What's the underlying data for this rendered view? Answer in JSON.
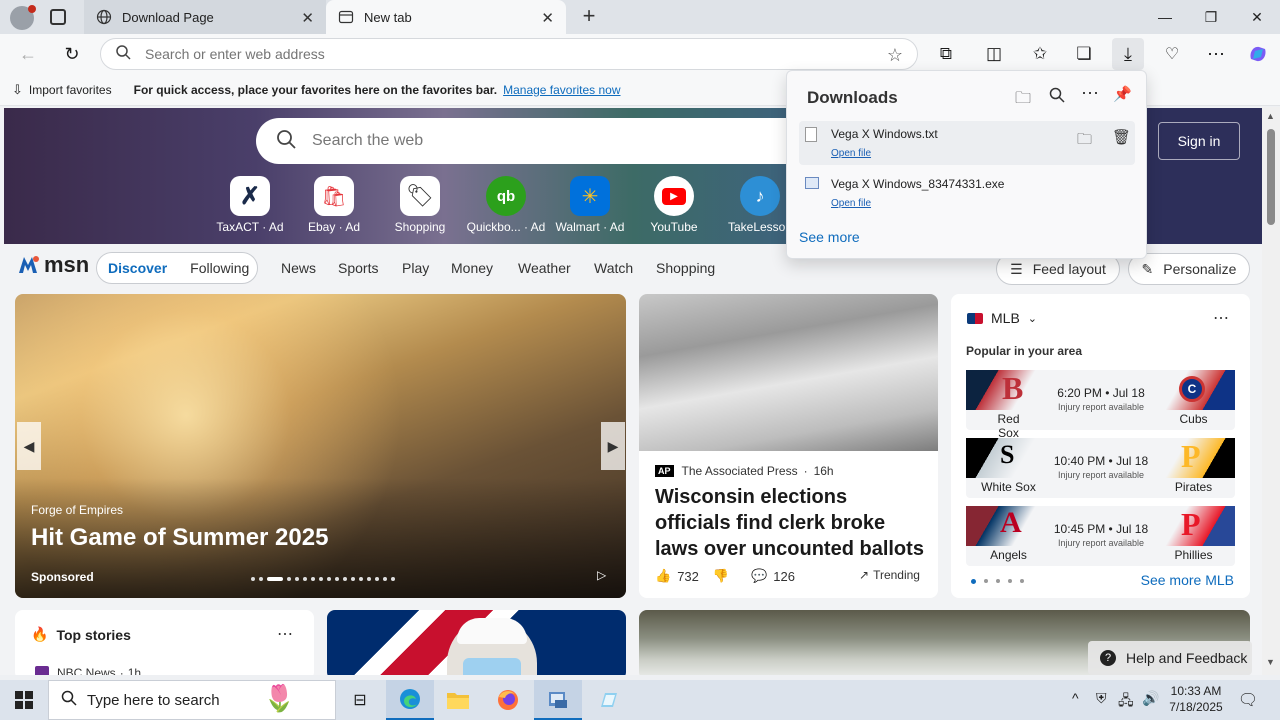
{
  "browser": {
    "tabs": [
      {
        "title": "Download Page"
      },
      {
        "title": "New tab"
      }
    ],
    "address": {
      "placeholder": "Search or enter web address"
    }
  },
  "favorites_bar": {
    "import_label": "Import favorites",
    "message": "For quick access, place your favorites here on the favorites bar.",
    "manage_link": "Manage favorites now"
  },
  "downloads": {
    "title": "Downloads",
    "items": [
      {
        "name": "Vega X Windows.txt",
        "action": "Open file"
      },
      {
        "name": "Vega X Windows_83474331.exe",
        "action": "Open file"
      }
    ],
    "see_more": "See more"
  },
  "hero": {
    "search_placeholder": "Search the web",
    "signin": "Sign in",
    "quicklinks": [
      {
        "label": "TaxACT",
        "ad": "Ad"
      },
      {
        "label": "Ebay",
        "ad": "Ad"
      },
      {
        "label": "Shopping",
        "ad": ""
      },
      {
        "label": "Quickbo...",
        "ad": "Ad"
      },
      {
        "label": "Walmart",
        "ad": "Ad"
      },
      {
        "label": "YouTube",
        "ad": ""
      },
      {
        "label": "TakeLesson",
        "ad": ""
      }
    ]
  },
  "msn": {
    "logo": "msn",
    "tabs": [
      {
        "label": "Discover"
      },
      {
        "label": "Following"
      }
    ],
    "nav": [
      "News",
      "Sports",
      "Play",
      "Money",
      "Weather",
      "Watch",
      "Shopping"
    ],
    "feed_layout": "Feed layout",
    "personalize": "Personalize"
  },
  "carousel": {
    "source": "Forge of Empires",
    "headline": "Hit Game of Summer 2025",
    "sponsored": "Sponsored"
  },
  "news": {
    "source": "The Associated Press",
    "age": "16h",
    "headline": "Wisconsin elections officials find clerk broke laws over uncounted ballots",
    "likes": "732",
    "comments": "126",
    "trending": "Trending"
  },
  "mlb": {
    "title": "MLB",
    "subtitle": "Popular in your area",
    "games": [
      {
        "home": "Red Sox",
        "away": "Cubs",
        "time": "6:20 PM • Jul 18",
        "note": "Injury report available"
      },
      {
        "home": "White Sox",
        "away": "Pirates",
        "time": "10:40 PM • Jul 18",
        "note": "Injury report available"
      },
      {
        "home": "Angels",
        "away": "Phillies",
        "time": "10:45 PM • Jul 18",
        "note": "Injury report available"
      }
    ],
    "see_more": "See more MLB"
  },
  "top_stories": {
    "title": "Top stories",
    "first_source": "NBC News",
    "first_age": "1h"
  },
  "help": {
    "label": "Help and Feedback"
  },
  "taskbar": {
    "search_placeholder": "Type here to search",
    "time": "10:33 AM",
    "date": "7/18/2025"
  },
  "colors": {
    "accent": "#0f6cbd",
    "msn_blue": "#0f6cbd",
    "taskbar": "#dce3ec"
  }
}
